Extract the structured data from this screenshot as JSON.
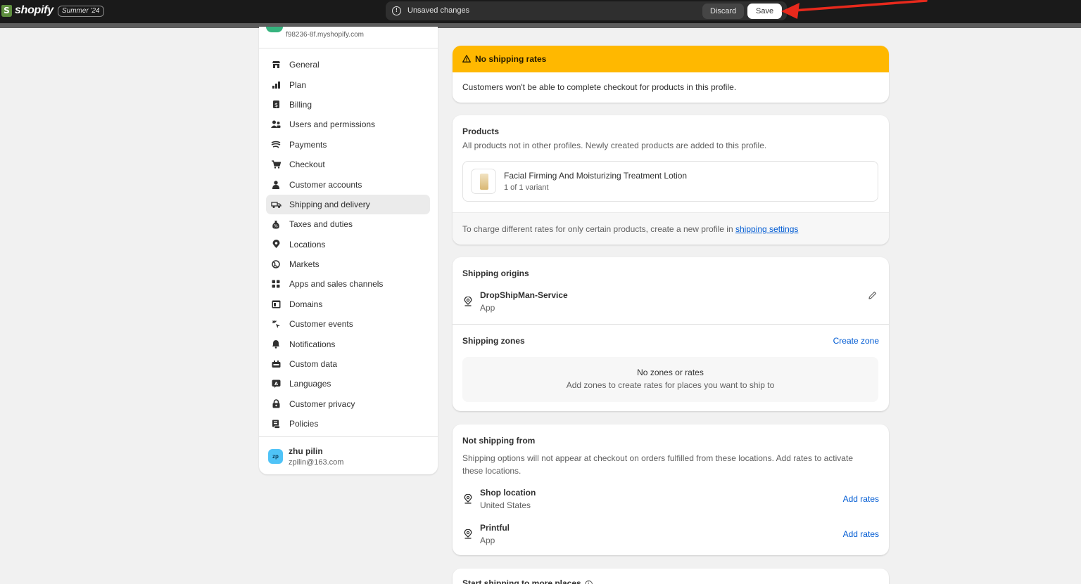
{
  "topbar": {
    "logo_glyph": "S",
    "brand": "shopify",
    "edition": "Summer '24",
    "unsaved_text": "Unsaved changes",
    "discard_label": "Discard",
    "save_label": "Save",
    "annotation_arrow_color": "#e8291c"
  },
  "sidebar": {
    "store_url": "f98236-8f.myshopify.com",
    "items": [
      {
        "label": "General",
        "icon": "store-icon"
      },
      {
        "label": "Plan",
        "icon": "plan-icon"
      },
      {
        "label": "Billing",
        "icon": "billing-icon"
      },
      {
        "label": "Users and permissions",
        "icon": "users-icon"
      },
      {
        "label": "Payments",
        "icon": "payments-icon"
      },
      {
        "label": "Checkout",
        "icon": "cart-icon"
      },
      {
        "label": "Customer accounts",
        "icon": "person-icon"
      },
      {
        "label": "Shipping and delivery",
        "icon": "truck-icon"
      },
      {
        "label": "Taxes and duties",
        "icon": "tax-icon"
      },
      {
        "label": "Locations",
        "icon": "location-icon"
      },
      {
        "label": "Markets",
        "icon": "globe-icon"
      },
      {
        "label": "Apps and sales channels",
        "icon": "apps-icon"
      },
      {
        "label": "Domains",
        "icon": "domain-icon"
      },
      {
        "label": "Customer events",
        "icon": "sparkle-icon"
      },
      {
        "label": "Notifications",
        "icon": "bell-icon"
      },
      {
        "label": "Custom data",
        "icon": "custom-data-icon"
      },
      {
        "label": "Languages",
        "icon": "language-icon"
      },
      {
        "label": "Customer privacy",
        "icon": "lock-icon"
      },
      {
        "label": "Policies",
        "icon": "policy-icon"
      }
    ],
    "user": {
      "initials": "zp",
      "name": "zhu pilin",
      "email": "zpilin@163.com"
    }
  },
  "warning": {
    "title": "No shipping rates",
    "body": "Customers won't be able to complete checkout for products in this profile."
  },
  "products": {
    "title": "Products",
    "description": "All products not in other profiles. Newly created products are added to this profile.",
    "product_name": "Facial Firming And Moisturizing Treatment Lotion",
    "variant": "1 of 1 variant",
    "footer_prefix": "To charge different rates for only certain products, create a new profile in",
    "footer_link": "shipping settings"
  },
  "origins": {
    "title": "Shipping origins",
    "name": "DropShipMan-Service",
    "type": "App",
    "zones_title": "Shipping zones",
    "create_zone": "Create zone",
    "empty_title": "No zones or rates",
    "empty_sub": "Add zones to create rates for places you want to ship to"
  },
  "not_shipping": {
    "title": "Not shipping from",
    "description_line1": "Shipping options will not appear at checkout on orders fulfilled from these locations. Add rates to activate",
    "description_line2": "these locations.",
    "locations": [
      {
        "name": "Shop location",
        "sub": "United States",
        "action": "Add rates"
      },
      {
        "name": "Printful",
        "sub": "App",
        "action": "Add rates"
      }
    ]
  },
  "start_shipping": {
    "title": "Start shipping to more places"
  }
}
